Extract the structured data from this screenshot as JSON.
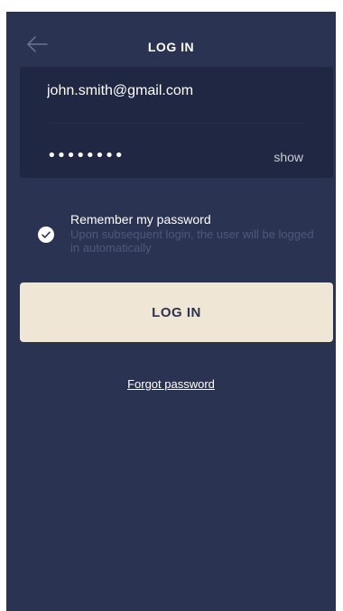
{
  "header": {
    "title": "LOG IN",
    "back_icon": "arrow-left-icon"
  },
  "form": {
    "email_value": "john.smith@gmail.com",
    "password_value": "••••••••",
    "show_label": "show"
  },
  "remember": {
    "checked": true,
    "check_icon": "check-circle-icon",
    "label": "Remember my password",
    "hint": "Upon subsequent login, the user will be logged in automatically"
  },
  "actions": {
    "login_label": "LOG IN",
    "forgot_label": "Forgot password"
  },
  "colors": {
    "background": "#2b3352",
    "card": "#1f2743",
    "button": "#efe6d5",
    "hint_text": "#50587a"
  }
}
